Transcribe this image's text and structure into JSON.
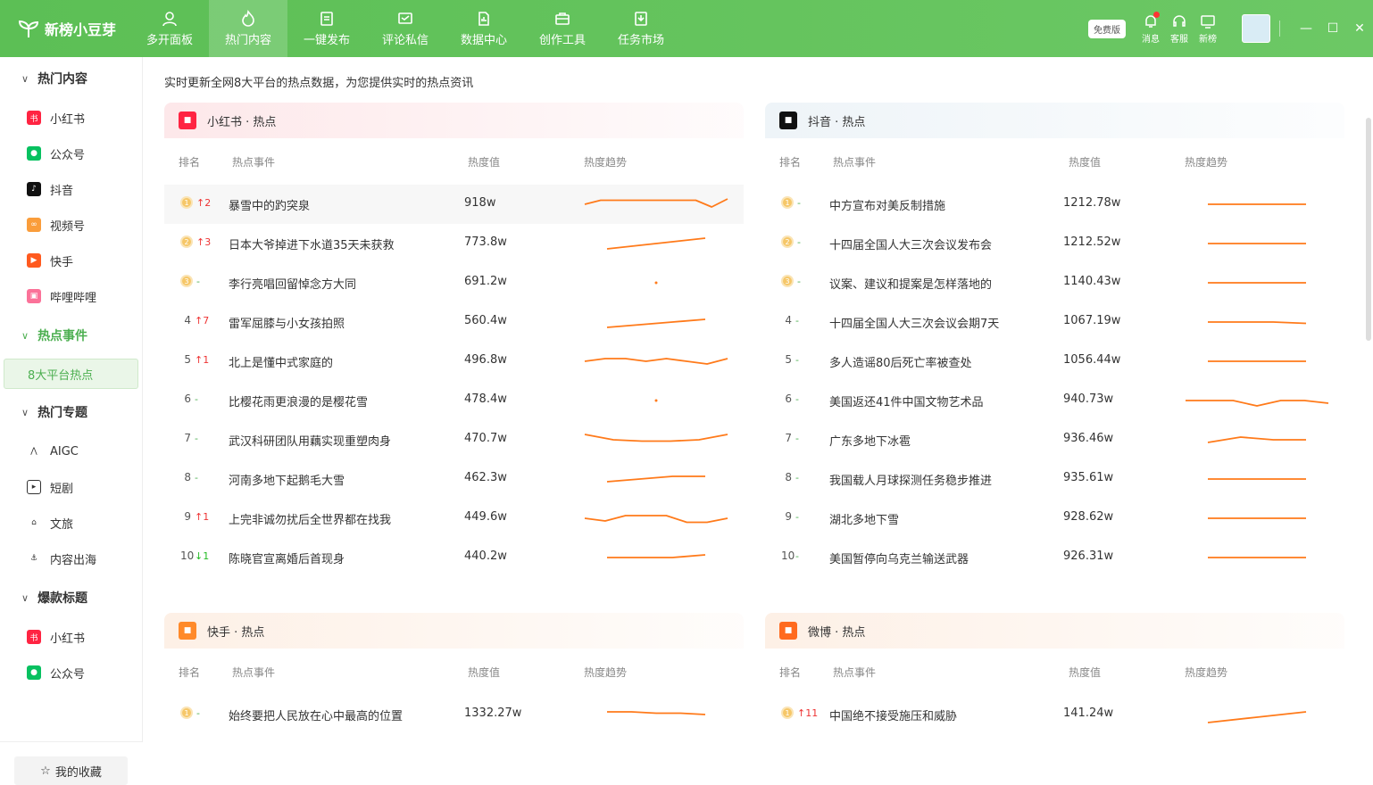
{
  "app": {
    "name": "新榜小豆芽"
  },
  "nav": [
    {
      "label": "多开面板",
      "icon": "user-icon"
    },
    {
      "label": "热门内容",
      "icon": "flame-icon",
      "active": true
    },
    {
      "label": "一键发布",
      "icon": "publish-icon"
    },
    {
      "label": "评论私信",
      "icon": "comment-icon"
    },
    {
      "label": "数据中心",
      "icon": "data-icon"
    },
    {
      "label": "创作工具",
      "icon": "toolbox-icon"
    },
    {
      "label": "任务市场",
      "icon": "task-icon"
    }
  ],
  "header": {
    "free_badge": "免费版",
    "message": "消息",
    "service": "客服",
    "newbang": "新榜"
  },
  "sidebar": {
    "groups": [
      {
        "label": "热门内容",
        "items": [
          {
            "label": "小红书",
            "icon": "xiaohongshu-icon",
            "color": "#ff2442"
          },
          {
            "label": "公众号",
            "icon": "wechat-icon",
            "color": "#07c160"
          },
          {
            "label": "抖音",
            "icon": "douyin-icon",
            "color": "#111111"
          },
          {
            "label": "视频号",
            "icon": "channels-icon",
            "color": "#fa9d3b"
          },
          {
            "label": "快手",
            "icon": "kuaishou-icon",
            "color": "#ff5a1f"
          },
          {
            "label": "哔哩哔哩",
            "icon": "bilibili-icon",
            "color": "#fb7299"
          }
        ]
      },
      {
        "label": "热点事件",
        "items": [],
        "sub": "8大平台热点"
      },
      {
        "label": "热门专题",
        "items": [
          {
            "label": "AIGC",
            "icon": "aigc-icon"
          },
          {
            "label": "短剧",
            "icon": "play-icon"
          },
          {
            "label": "文旅",
            "icon": "travel-icon"
          },
          {
            "label": "内容出海",
            "icon": "ship-icon"
          }
        ]
      },
      {
        "label": "爆款标题",
        "items": [
          {
            "label": "小红书",
            "icon": "xiaohongshu-icon",
            "color": "#ff2442"
          },
          {
            "label": "公众号",
            "icon": "wechat-icon",
            "color": "#07c160"
          }
        ]
      }
    ],
    "favorites": "我的收藏"
  },
  "main": {
    "intro": "实时更新全网8大平台的热点数据，为您提供实时的热点资讯",
    "columns": {
      "rank": "排名",
      "event": "热点事件",
      "heat": "热度值",
      "trend": "热度趋势"
    },
    "cards": [
      {
        "title": "小红书 · 热点",
        "icon": "xiaohongshu-icon",
        "icon_color": "#ff2442",
        "head_color": "#fde8ea",
        "rows": [
          {
            "rank": "1",
            "change": "↑2",
            "dir": "up",
            "event": "暴雪中的趵突泉",
            "heat": "918w",
            "trend": [
              0.5,
              0.35,
              0.35,
              0.35,
              0.35,
              0.35,
              0.35,
              0.35,
              0.6,
              0.3
            ]
          },
          {
            "rank": "2",
            "change": "↑3",
            "dir": "up",
            "event": "日本大爷掉进下水道35天未获救",
            "heat": "773.8w",
            "trend": [
              0.7,
              0.6,
              0.5,
              0.4,
              0.3
            ]
          },
          {
            "rank": "3",
            "change": "-",
            "dir": "same",
            "event": "李行亮唱回留悼念方大同",
            "heat": "691.2w",
            "trend": [
              0.5
            ]
          },
          {
            "rank": "4",
            "change": "↑7",
            "dir": "up",
            "event": "雷军屈膝与小女孩拍照",
            "heat": "560.4w",
            "trend": [
              0.7,
              0.6,
              0.5,
              0.4
            ]
          },
          {
            "rank": "5",
            "change": "↑1",
            "dir": "up",
            "event": "北上是懂中式家庭的",
            "heat": "496.8w",
            "trend": [
              0.5,
              0.4,
              0.4,
              0.5,
              0.4,
              0.5,
              0.6,
              0.4
            ]
          },
          {
            "rank": "6",
            "change": "-",
            "dir": "same",
            "event": "比樱花雨更浪漫的是樱花雪",
            "heat": "478.4w",
            "trend": [
              0.5
            ]
          },
          {
            "rank": "7",
            "change": "-",
            "dir": "same",
            "event": "武汉科研团队用藕实现重塑肉身",
            "heat": "470.7w",
            "trend": [
              0.3,
              0.5,
              0.55,
              0.55,
              0.5,
              0.3
            ]
          },
          {
            "rank": "8",
            "change": "-",
            "dir": "same",
            "event": "河南多地下起鹅毛大雪",
            "heat": "462.3w",
            "trend": [
              0.6,
              0.5,
              0.4,
              0.4
            ]
          },
          {
            "rank": "9",
            "change": "↑1",
            "dir": "up",
            "event": "上完非诚勿扰后全世界都在找我",
            "heat": "449.6w",
            "trend": [
              0.5,
              0.6,
              0.4,
              0.4,
              0.4,
              0.65,
              0.65,
              0.5
            ]
          },
          {
            "rank": "10",
            "change": "↓1",
            "dir": "down",
            "event": "陈晓官宣离婚后首现身",
            "heat": "440.2w",
            "trend": [
              0.5,
              0.5,
              0.5,
              0.4
            ]
          }
        ]
      },
      {
        "title": "抖音 · 热点",
        "icon": "douyin-icon",
        "icon_color": "#111111",
        "head_color": "#eef4f8",
        "rows": [
          {
            "rank": "1",
            "change": "-",
            "dir": "same",
            "event": "中方宣布对美反制措施",
            "heat": "1212.78w",
            "trend": [
              0.5,
              0.5,
              0.5,
              0.5
            ]
          },
          {
            "rank": "2",
            "change": "-",
            "dir": "same",
            "event": "十四届全国人大三次会议发布会",
            "heat": "1212.52w",
            "trend": [
              0.5,
              0.5,
              0.5,
              0.5
            ]
          },
          {
            "rank": "3",
            "change": "-",
            "dir": "same",
            "event": "议案、建议和提案是怎样落地的",
            "heat": "1140.43w",
            "trend": [
              0.5,
              0.5,
              0.5,
              0.5
            ]
          },
          {
            "rank": "4",
            "change": "-",
            "dir": "same",
            "event": "十四届全国人大三次会议会期7天",
            "heat": "1067.19w",
            "trend": [
              0.5,
              0.5,
              0.5,
              0.55
            ]
          },
          {
            "rank": "5",
            "change": "-",
            "dir": "same",
            "event": "多人造谣80后死亡率被查处",
            "heat": "1056.44w",
            "trend": [
              0.5,
              0.5,
              0.5,
              0.5
            ]
          },
          {
            "rank": "6",
            "change": "-",
            "dir": "same",
            "event": "美国返还41件中国文物艺术品",
            "heat": "940.73w",
            "trend": [
              0.5,
              0.5,
              0.5,
              0.7,
              0.5,
              0.5,
              0.6
            ]
          },
          {
            "rank": "7",
            "change": "-",
            "dir": "same",
            "event": "广东多地下冰雹",
            "heat": "936.46w",
            "trend": [
              0.6,
              0.4,
              0.5,
              0.5
            ]
          },
          {
            "rank": "8",
            "change": "-",
            "dir": "same",
            "event": "我国载人月球探测任务稳步推进",
            "heat": "935.61w",
            "trend": [
              0.5,
              0.5,
              0.5,
              0.5
            ]
          },
          {
            "rank": "9",
            "change": "-",
            "dir": "same",
            "event": "湖北多地下雪",
            "heat": "928.62w",
            "trend": [
              0.5,
              0.5,
              0.5,
              0.5
            ]
          },
          {
            "rank": "10",
            "change": "-",
            "dir": "same",
            "event": "美国暂停向乌克兰输送武器",
            "heat": "926.31w",
            "trend": [
              0.5,
              0.5,
              0.5,
              0.5
            ]
          }
        ]
      },
      {
        "title": "快手 · 热点",
        "icon": "kuaishou-icon",
        "icon_color": "#ff8a2a",
        "head_color": "#fdf0e6",
        "rows": [
          {
            "rank": "1",
            "change": "-",
            "dir": "same",
            "event": "始终要把人民放在心中最高的位置",
            "heat": "1332.27w",
            "trend": [
              0.4,
              0.4,
              0.45,
              0.45,
              0.5
            ]
          }
        ]
      },
      {
        "title": "微博 · 热点",
        "icon": "weibo-icon",
        "icon_color": "#ff6a1e",
        "head_color": "#fdf0e6",
        "rows": [
          {
            "rank": "1",
            "change": "↑11",
            "dir": "up",
            "event": "中国绝不接受施压和威胁",
            "heat": "141.24w",
            "trend": [
              0.8,
              0.6,
              0.4
            ]
          }
        ]
      }
    ]
  }
}
